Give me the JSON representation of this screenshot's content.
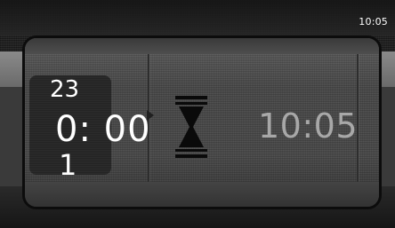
{
  "status_bar": {
    "clock": "10:05"
  },
  "timer": {
    "picker": {
      "previous_value": "23",
      "current_value": "0: 00",
      "next_value": "1"
    },
    "hourglass_icon": "hourglass-icon",
    "end_time": "10:05"
  },
  "colors": {
    "text_primary": "#ffffff",
    "text_secondary": "#a8a8a8",
    "panel_border": "#0c0c0c"
  }
}
